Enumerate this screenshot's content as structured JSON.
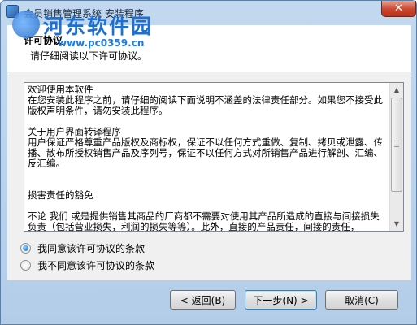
{
  "window": {
    "title": "会员销售管理系统 安装程序",
    "close_label": "✕"
  },
  "watermark": {
    "text": "河东软件园",
    "url": "www.pc0359.cn"
  },
  "header": {
    "title": "许可协议",
    "subtitle": "请仔细阅读以下许可协议。"
  },
  "license": {
    "text": "欢迎使用本软件\n在您安装此程序之前，请仔细的阅读下面说明不涵盖的法律责任部分。如果您不接受此版权声明条件，请勿安装此程序。\n\n关于用户界面转译程序\n用户保证严格尊重产品版权及商标权，保证不以任何方式重做、复制、拷贝或泄露、传播、散布所授权销售产品及序列号，保证不以任何方式对所销售产品进行解剖、汇编、反汇编。\n\n\n损害责任的豁免\n\n不论 我们 或是提供销售其商品的厂商都不需要对使用其产品所造成的直接与间接损失负责（包括营业损失，利润的损失等等）。此外，直接的产品责任，间接的责任，"
  },
  "options": {
    "accept": "我同意该许可协议的条款",
    "decline": "我不同意该许可协议的条款",
    "selected": "accept"
  },
  "buttons": {
    "back": "< 返回(B)",
    "next": "下一步(N) >",
    "cancel": "取消(C)"
  }
}
